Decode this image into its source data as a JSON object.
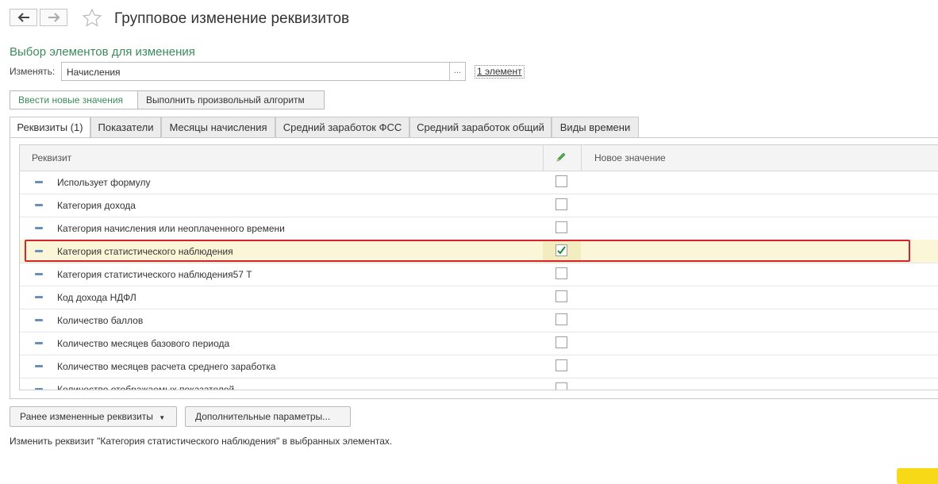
{
  "header": {
    "title": "Групповое изменение реквизитов"
  },
  "selection": {
    "section_title": "Выбор элементов для изменения",
    "change_label": "Изменять:",
    "change_value": "Начисления",
    "dots": "...",
    "elements_link": "1 элемент"
  },
  "mode_buttons": [
    {
      "label": "Ввести новые значения",
      "active": true
    },
    {
      "label": "Выполнить произвольный алгоритм",
      "active": false
    }
  ],
  "tabs": [
    {
      "label": "Реквизиты (1)",
      "active": true
    },
    {
      "label": "Показатели",
      "active": false
    },
    {
      "label": "Месяцы начисления",
      "active": false
    },
    {
      "label": "Средний заработок ФСС",
      "active": false
    },
    {
      "label": "Средний заработок общий",
      "active": false
    },
    {
      "label": "Виды времени",
      "active": false
    }
  ],
  "table": {
    "col_attribute": "Реквизит",
    "col_new_value": "Новое значение",
    "rows": [
      {
        "label": "Использует формулу",
        "checked": false
      },
      {
        "label": "Категория дохода",
        "checked": false
      },
      {
        "label": "Категория начисления или неоплаченного времени",
        "checked": false
      },
      {
        "label": "Категория статистического наблюдения",
        "checked": true
      },
      {
        "label": "Категория статистического наблюдения57 Т",
        "checked": false
      },
      {
        "label": "Код дохода НДФЛ",
        "checked": false
      },
      {
        "label": "Количество баллов",
        "checked": false
      },
      {
        "label": "Количество месяцев базового периода",
        "checked": false
      },
      {
        "label": "Количество месяцев расчета среднего заработка",
        "checked": false
      },
      {
        "label": "Количество отображаемых показателей",
        "checked": false
      }
    ]
  },
  "bottom": {
    "changed_button": "Ранее измененные реквизиты",
    "params_button": "Дополнительные параметры...",
    "hint": "Изменить реквизит \"Категория статистического наблюдения\" в выбранных элементах."
  },
  "colors": {
    "accent_green": "#3d8b5c",
    "highlight_red": "#d9232a",
    "selected_row": "#fbf6d8"
  }
}
